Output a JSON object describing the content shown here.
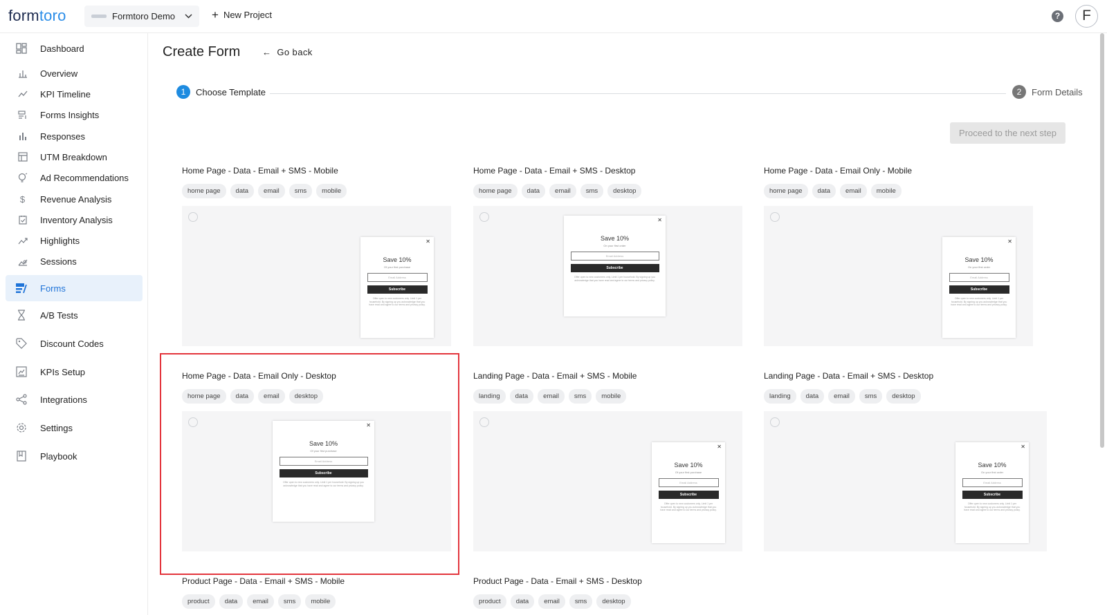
{
  "header": {
    "logo_left": "form",
    "logo_right": "toro",
    "project_name": "Formtoro Demo",
    "new_project_label": "New Project",
    "avatar_letter": "F",
    "help_symbol": "?"
  },
  "sidebar": {
    "items": [
      {
        "label": "Dashboard",
        "icon": "dashboard-icon"
      },
      {
        "label": "Overview",
        "icon": "bar-chart-icon"
      },
      {
        "label": "KPI Timeline",
        "icon": "line-chart-icon"
      },
      {
        "label": "Forms Insights",
        "icon": "forms-insights-icon"
      },
      {
        "label": "Responses",
        "icon": "column-chart-icon"
      },
      {
        "label": "UTM Breakdown",
        "icon": "table-icon"
      },
      {
        "label": "Ad Recommendations",
        "icon": "lightbulb-icon"
      },
      {
        "label": "Revenue Analysis",
        "icon": "dollar-icon"
      },
      {
        "label": "Inventory Analysis",
        "icon": "inventory-icon"
      },
      {
        "label": "Highlights",
        "icon": "trend-icon"
      },
      {
        "label": "Sessions",
        "icon": "sessions-icon"
      },
      {
        "label": "Forms",
        "icon": "forms-icon"
      },
      {
        "label": "A/B Tests",
        "icon": "hourglass-icon"
      },
      {
        "label": "Discount Codes",
        "icon": "tag-icon"
      },
      {
        "label": "KPIs Setup",
        "icon": "kpi-setup-icon"
      },
      {
        "label": "Integrations",
        "icon": "share-icon"
      },
      {
        "label": "Settings",
        "icon": "gear-icon"
      },
      {
        "label": "Playbook",
        "icon": "book-icon"
      }
    ],
    "active": "Forms"
  },
  "main": {
    "title": "Create Form",
    "go_back": "Go back",
    "steps": [
      {
        "number": "1",
        "label": "Choose Template"
      },
      {
        "number": "2",
        "label": "Form Details"
      }
    ],
    "proceed_label": "Proceed to the next step",
    "popup": {
      "heading": "Save 10%",
      "sub_purchase": "Of your first purchase",
      "sub_order": "On your first order",
      "input_placeholder": "Email Address",
      "button": "Subscribe",
      "fine_print": "Offer open to new customers only. Limit 1 per household. By signing up you acknowledge that you have read and agree to our terms and privacy policy."
    },
    "templates": [
      {
        "title": "Home Page - Data - Email + SMS - Mobile",
        "tags": [
          "home page",
          "data",
          "email",
          "sms",
          "mobile"
        ]
      },
      {
        "title": "Home Page - Data - Email + SMS - Desktop",
        "tags": [
          "home page",
          "data",
          "email",
          "sms",
          "desktop"
        ]
      },
      {
        "title": "Home Page - Data - Email Only - Mobile",
        "tags": [
          "home page",
          "data",
          "email",
          "mobile"
        ]
      },
      {
        "title": "Home Page - Data - Email Only - Desktop",
        "tags": [
          "home page",
          "data",
          "email",
          "desktop"
        ]
      },
      {
        "title": "Landing Page - Data - Email + SMS - Mobile",
        "tags": [
          "landing",
          "data",
          "email",
          "sms",
          "mobile"
        ]
      },
      {
        "title": "Landing Page - Data - Email + SMS - Desktop",
        "tags": [
          "landing",
          "data",
          "email",
          "sms",
          "desktop"
        ]
      },
      {
        "title": "Product Page - Data - Email + SMS - Mobile",
        "tags": [
          "product",
          "data",
          "email",
          "sms",
          "mobile"
        ]
      },
      {
        "title": "Product Page - Data - Email + SMS - Desktop",
        "tags": [
          "product",
          "data",
          "email",
          "sms",
          "desktop"
        ]
      }
    ]
  },
  "colors": {
    "accent": "#1e73d8",
    "step_active": "#1e8be0",
    "highlight": "#e3343c"
  }
}
